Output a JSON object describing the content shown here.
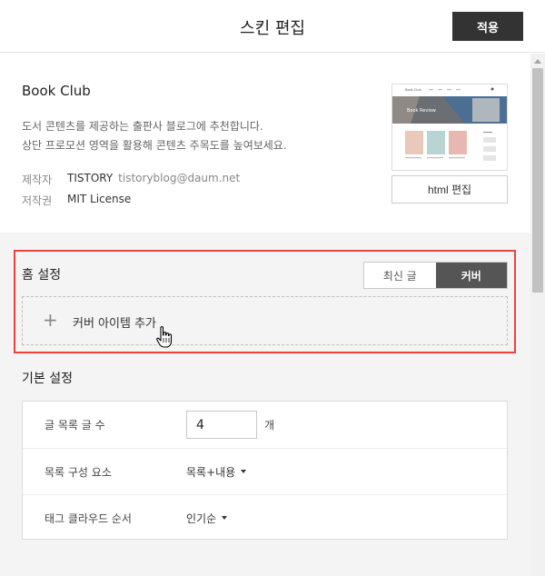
{
  "header": {
    "title": "스킨 편집",
    "apply_label": "적용"
  },
  "skin": {
    "name": "Book Club",
    "description_line1": "도서 콘텐츠를 제공하는 출판사 블로그에 추천합니다.",
    "description_line2": "상단 프로모션 영역을 활용해 콘텐츠 주목도를 높여보세요.",
    "maker_label": "제작자",
    "maker_name": "TISTORY",
    "maker_email": "tistoryblog@daum.net",
    "license_label": "저작권",
    "license_value": "MIT License",
    "thumb_brand": "Book Club",
    "thumb_banner": "Book Review",
    "html_edit_label": "html 편집"
  },
  "home": {
    "title": "홈 설정",
    "tabs": [
      {
        "label": "최신 글",
        "active": false
      },
      {
        "label": "커버",
        "active": true
      }
    ],
    "add_cover_label": "커버 아이템 추가"
  },
  "basic": {
    "title": "기본 설정",
    "rows": [
      {
        "label": "글 목록 글 수",
        "value": "4",
        "unit": "개"
      },
      {
        "label": "목록 구성 요소",
        "value": "목록+내용"
      },
      {
        "label": "태그 클라우드 순서",
        "value": "인기순"
      }
    ]
  },
  "colors": {
    "accent_highlight": "#f0413f",
    "button_dark": "#333333",
    "settings_bg": "#f4f4f4"
  },
  "icons": [
    "plus-icon",
    "caret-down-icon",
    "hand-pointer-cursor",
    "scroll-up-arrow-icon"
  ]
}
